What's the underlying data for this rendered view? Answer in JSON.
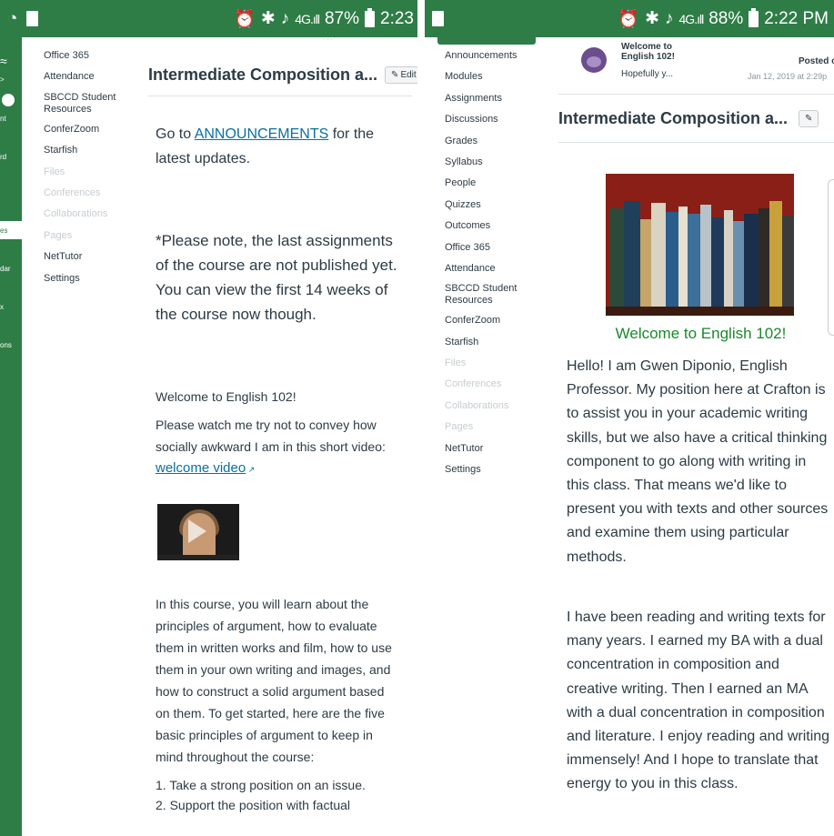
{
  "left": {
    "status": {
      "battery": "87%",
      "time": "2:23"
    },
    "nav_fragments": [
      "nt",
      "rd",
      "es",
      "dar",
      "x",
      "ons"
    ],
    "course_nav": [
      {
        "label": "Office 365",
        "disabled": false
      },
      {
        "label": "Attendance",
        "disabled": false
      },
      {
        "label": "SBCCD Student Resources",
        "disabled": false,
        "multi": true
      },
      {
        "label": "ConferZoom",
        "disabled": false
      },
      {
        "label": "Starfish",
        "disabled": false
      },
      {
        "label": "Files",
        "disabled": true
      },
      {
        "label": "Conferences",
        "disabled": true
      },
      {
        "label": "Collaborations",
        "disabled": true
      },
      {
        "label": "Pages",
        "disabled": true
      },
      {
        "label": "NetTutor",
        "disabled": false
      },
      {
        "label": "Settings",
        "disabled": false
      }
    ],
    "page_title": "Intermediate Composition a...",
    "edit_label": "Edit",
    "goto_prefix": "Go to ",
    "goto_link": "ANNOUNCEMENTS",
    "goto_suffix": " for the latest updates.",
    "note": "*Please note, the last assignments of the course are not published yet. You can view the first 14 weeks of the course now though.",
    "welcome_heading": "Welcome to English 102!",
    "watch_text": "Please watch me try not to convey how socially awkward I am in this short video:",
    "video_link": "welcome video",
    "course_intro": "In this course, you will learn about the principles of argument, how to evaluate them in written works and film, how to use them in your own writing and images, and how to construct a solid argument based on them. To get started, here are the five basic principles of argument to keep in mind throughout the course:",
    "principles": [
      "1. Take a strong position on an issue.",
      "2. Support the position with factual"
    ]
  },
  "right": {
    "status": {
      "battery": "88%",
      "time": "2:22 PM"
    },
    "course_nav": [
      {
        "label": "Announcements",
        "disabled": false
      },
      {
        "label": "Modules",
        "disabled": false
      },
      {
        "label": "Assignments",
        "disabled": false
      },
      {
        "label": "Discussions",
        "disabled": false
      },
      {
        "label": "Grades",
        "disabled": false
      },
      {
        "label": "Syllabus",
        "disabled": false
      },
      {
        "label": "People",
        "disabled": false
      },
      {
        "label": "Quizzes",
        "disabled": false
      },
      {
        "label": "Outcomes",
        "disabled": false
      },
      {
        "label": "Office 365",
        "disabled": false
      },
      {
        "label": "Attendance",
        "disabled": false
      },
      {
        "label": "SBCCD Student Resources",
        "disabled": false,
        "multi": true
      },
      {
        "label": "ConferZoom",
        "disabled": false
      },
      {
        "label": "Starfish",
        "disabled": false
      },
      {
        "label": "Files",
        "disabled": true
      },
      {
        "label": "Conferences",
        "disabled": true
      },
      {
        "label": "Collaborations",
        "disabled": true
      },
      {
        "label": "Pages",
        "disabled": true
      },
      {
        "label": "NetTutor",
        "disabled": false
      },
      {
        "label": "Settings",
        "disabled": false
      }
    ],
    "announcement": {
      "title_line1": "Welcome to",
      "title_line2": "English 102!",
      "preview": "Hopefully y...",
      "posted_label": "Posted o",
      "posted_date": "Jan 12, 2019 at 2:29p"
    },
    "page_title": "Intermediate Composition a...",
    "welcome_heading": "Welcome to English 102!",
    "para1": "Hello! I am Gwen Diponio, English Professor. My position here at Crafton is to assist you in your academic writing skills, but we also have a critical thinking component to go along with writing in this class. That means we'd like to present you with texts and other sources and examine them using particular methods.",
    "para2": "I have been reading and writing texts for many years. I earned my BA with a dual concentration in composition and creative writing. Then I earned an MA with a dual concentration in composition and literature. I enjoy reading and writing immensely! And I hope to translate that energy to you in this class."
  }
}
